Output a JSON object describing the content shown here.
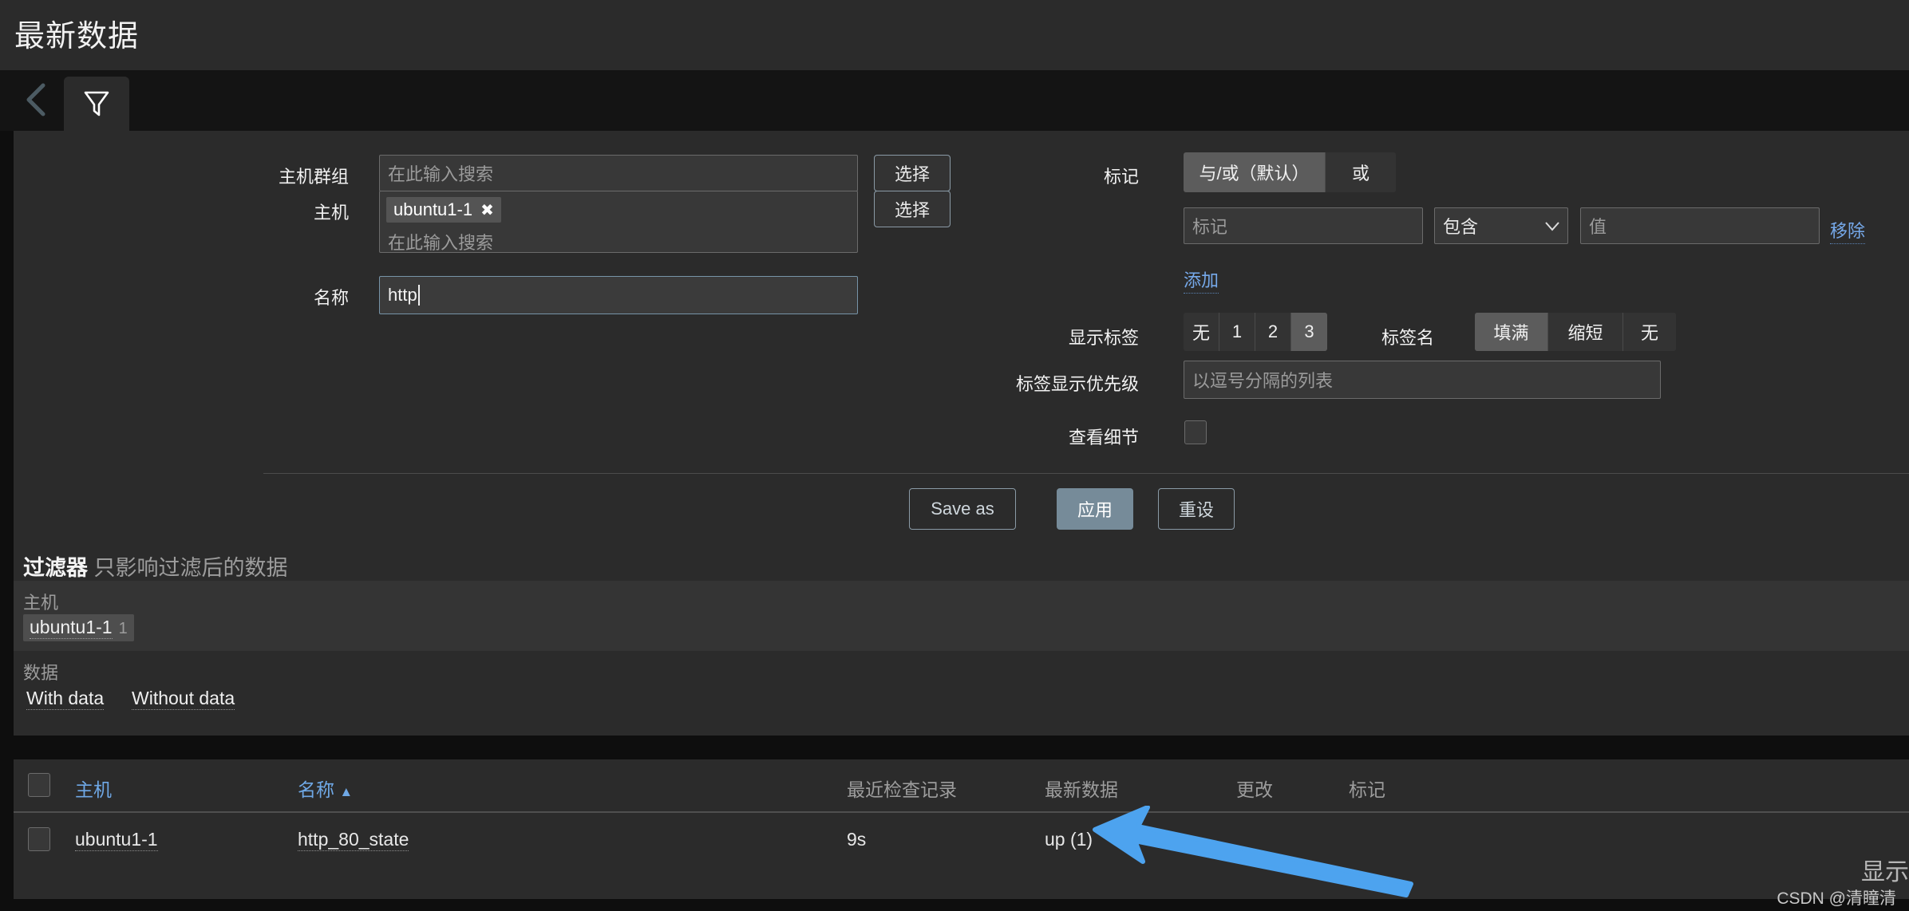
{
  "header": {
    "title": "最新数据"
  },
  "tabs": {
    "back_icon": "chevron-left-icon",
    "filter_icon": "filter-icon"
  },
  "form": {
    "hostgroup": {
      "label": "主机群组",
      "placeholder": "在此输入搜索",
      "value": "",
      "select_button": "选择"
    },
    "host": {
      "label": "主机",
      "placeholder": "在此输入搜索",
      "chips": [
        "ubuntu1-1"
      ],
      "chip_remove": "✖",
      "select_button": "选择"
    },
    "name": {
      "label": "名称",
      "value": "http",
      "placeholder": ""
    },
    "tags": {
      "label": "标记",
      "modes": [
        "与/或（默认）",
        "或"
      ],
      "mode_selected": "与/或（默认）",
      "tag_placeholder": "标记",
      "operator": "包含",
      "value_placeholder": "值",
      "remove_label": "移除",
      "add_label": "添加"
    },
    "show_tags": {
      "label": "显示标签",
      "options": [
        "无",
        "1",
        "2",
        "3"
      ],
      "selected": "3"
    },
    "tag_name": {
      "label": "标签名",
      "options": [
        "填满",
        "缩短",
        "无"
      ],
      "selected": "填满"
    },
    "tag_priority": {
      "label": "标签显示优先级",
      "placeholder": "以逗号分隔的列表",
      "value": ""
    },
    "show_details": {
      "label": "查看细节",
      "checked": false
    },
    "actions": {
      "save_as": "Save as",
      "apply": "应用",
      "reset": "重设"
    }
  },
  "filter_summary": {
    "title": "过滤器",
    "subtitle": "只影响过滤后的数据",
    "host_label": "主机",
    "host_chip": {
      "name": "ubuntu1-1",
      "count": "1"
    },
    "data_label": "数据",
    "data_links": [
      "With data",
      "Without data"
    ]
  },
  "table": {
    "columns": [
      "主机",
      "名称",
      "最近检查记录",
      "最新数据",
      "更改",
      "标记"
    ],
    "sort_column": "名称",
    "sort_arrow": "▲",
    "rows": [
      {
        "host": "ubuntu1-1",
        "name": "http_80_state",
        "last_check": "9s",
        "last_value": "up (1)",
        "change": "",
        "tags": ""
      }
    ]
  },
  "overlays": {
    "shown_ghost_text": "显示",
    "watermark": "CSDN @清瞳清",
    "arrow_color": "#4da3ef"
  }
}
